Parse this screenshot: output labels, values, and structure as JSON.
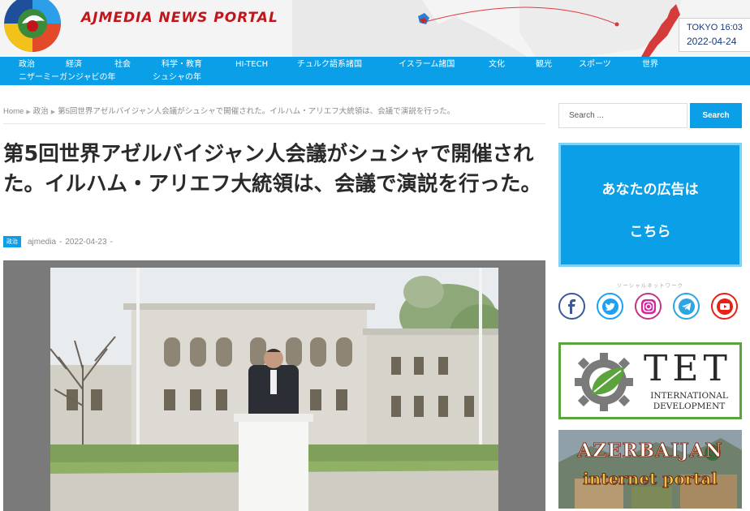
{
  "header": {
    "site_title": "AJMEDIA NEWS PORTAL",
    "clock_city": "TOKYO 16:03",
    "clock_date": "2022-04-24"
  },
  "nav": {
    "items": [
      "政治",
      "経済",
      "社会",
      "科学・教育",
      "HI-TECH",
      "チュルク語系諸国",
      "イスラーム諸国",
      "文化",
      "観光",
      "スポーツ",
      "世界",
      "ニザーミーガンジャビの年",
      "シュシャの年"
    ]
  },
  "breadcrumb": {
    "home": "Home",
    "category": "政治",
    "current": "第5回世界アゼルバイジャン人会議がシュシャで開催された。イルハム・アリエフ大統領は、会議で演説を行った。"
  },
  "article": {
    "title": "第5回世界アゼルバイジャン人会議がシュシャで開催された。イルハム・アリエフ大統領は、会議で演説を行った。",
    "category": "政治",
    "author": "ajmedia",
    "date": "2022-04-23",
    "meta_sep": "-"
  },
  "sidebar": {
    "search_placeholder": "Search ...",
    "search_button": "Search",
    "ad_line1": "あなたの広告は",
    "ad_line2": "こちら",
    "social_label": "ソーシャルネットワーク",
    "social": [
      {
        "icon": "facebook-icon",
        "glyph": "f",
        "color": "#3b5998"
      },
      {
        "icon": "twitter-icon",
        "glyph": "t",
        "color": "#1da1f2"
      },
      {
        "icon": "instagram-icon",
        "glyph": "◎",
        "color": "#c13584"
      },
      {
        "icon": "telegram-icon",
        "glyph": "➤",
        "color": "#2ca5e0"
      },
      {
        "icon": "youtube-icon",
        "glyph": "▶",
        "color": "#e62117"
      }
    ],
    "tet_title": "TET",
    "tet_sub_line1": "INTERNATIONAL",
    "tet_sub_line2": "DEVELOPMENT",
    "azp_line1": "AZERBAIJAN",
    "azp_line2": "internet portal"
  },
  "colors": {
    "accent": "#0b9fe7",
    "title_red": "#c0161b",
    "tet_green": "#5ba33c"
  }
}
